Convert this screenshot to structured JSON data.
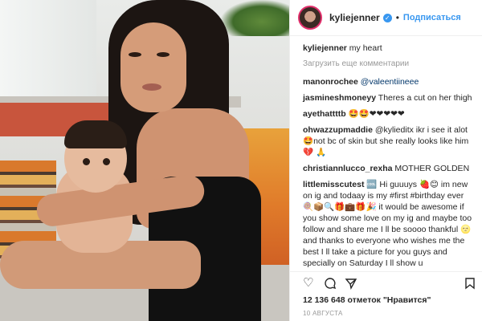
{
  "post": {
    "username": "kyliejenner",
    "follow_label": "Подписаться",
    "load_more": "Загрузить еще комментарии",
    "caption": {
      "user": "kyliejenner",
      "text": "my heart"
    },
    "comments": [
      {
        "user": "manonrochee",
        "text": "@valeentiineee"
      },
      {
        "user": "jasmineshmoneyy",
        "text": "Theres a cut on her thigh"
      },
      {
        "user": "ayethattttb",
        "text": "🤩🤩❤❤❤❤❤"
      },
      {
        "user": "ohwazzupmaddie",
        "text": "@kylieditx ikr i see it alot 🤩not bc of skin but she really looks like him💔 🙏"
      },
      {
        "user": "christiannlucco_rexha",
        "text": "MOTHER GOLDEN"
      },
      {
        "user": "littlemisscutest",
        "text": "🆒 Hi guuuys 🍓😊 im new on ig and todaay is my #first #birthday ever 🍭📦🔍🎁💼🎁🎉 it would be awesome if you show some love on my ig and maybe too follow and share me I ll be soooo thankful 🌝 and thanks to everyone who wishes me the best I ll take a picture for you guys and specially on Saturday I ll show u"
      }
    ],
    "likes": "12 136 648 отметок \"Нравится\"",
    "date": "10 АВГУСТА"
  },
  "colors": {
    "accent": "#3897f0",
    "text": "#262626",
    "muted": "#999999"
  },
  "icons": [
    "heart-icon",
    "comment-icon",
    "share-icon",
    "bookmark-icon"
  ]
}
